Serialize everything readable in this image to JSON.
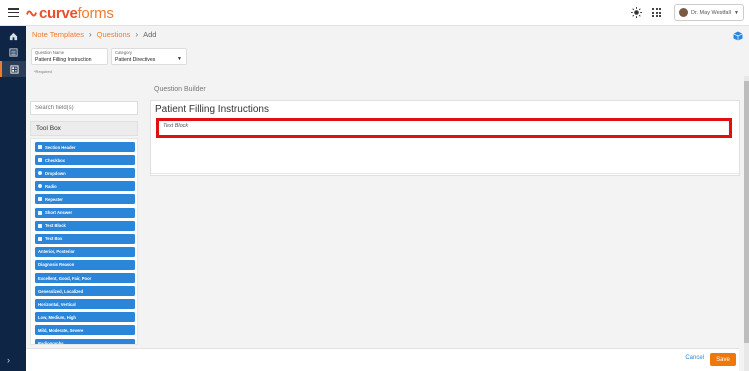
{
  "brand": {
    "part1": "curve",
    "part2": "forms",
    "accent": "#f07b2c",
    "accent_dark": "#e8502a"
  },
  "header": {
    "user_name": "Dr. May Westfall",
    "icons": [
      "hamburger-icon",
      "sun-icon",
      "apps-grid-icon"
    ]
  },
  "sidebar": {
    "items": [
      "home-icon",
      "list-icon",
      "forms-icon"
    ],
    "active_index": 2,
    "bg": "#0f2545"
  },
  "breadcrumb": {
    "items": [
      "Note Templates",
      "Questions",
      "Add"
    ],
    "sep": "›"
  },
  "form": {
    "question_name": {
      "label": "Question Name",
      "value": "Patient Filling Instruction"
    },
    "category": {
      "label": "Category",
      "value": "Patient Directives"
    },
    "required_note": "*Required"
  },
  "toolbox": {
    "search_placeholder": "Search field(s)",
    "title": "Tool Box",
    "items": [
      {
        "label": "Section Header",
        "icon": "header-icon"
      },
      {
        "label": "Checkbox",
        "icon": "checkbox-icon"
      },
      {
        "label": "Dropdown",
        "icon": "dropdown-icon"
      },
      {
        "label": "Radio",
        "icon": "radio-icon"
      },
      {
        "label": "Repeater",
        "icon": "repeater-icon"
      },
      {
        "label": "Short Answer",
        "icon": "short-answer-icon"
      },
      {
        "label": "Text Block",
        "icon": "text-block-icon"
      },
      {
        "label": "Text Box",
        "icon": "text-box-icon"
      },
      {
        "label": "Anterior, Posterior",
        "icon": ""
      },
      {
        "label": "Diagnosis Reason",
        "icon": ""
      },
      {
        "label": "Excellent, Good, Fair, Poor",
        "icon": ""
      },
      {
        "label": "Generalized, Localized",
        "icon": ""
      },
      {
        "label": "Horizontal, Vertical",
        "icon": ""
      },
      {
        "label": "Low, Medium, High",
        "icon": ""
      },
      {
        "label": "Mild, Moderate, Severe",
        "icon": ""
      },
      {
        "label": "Radiographs",
        "icon": ""
      }
    ]
  },
  "builder": {
    "label": "Question Builder",
    "title": "Patient Filling Instructions",
    "block_label": "Text Block",
    "highlight_color": "#e01010"
  },
  "footer": {
    "cancel_label": "Cancel",
    "save_label": "Save",
    "save_color": "#f0780a"
  }
}
